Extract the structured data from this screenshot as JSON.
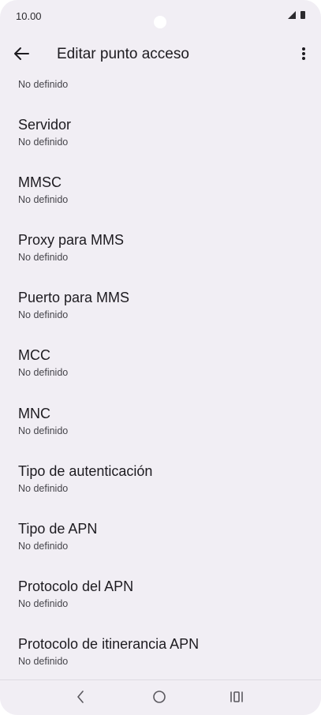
{
  "status_bar": {
    "time": "10.00"
  },
  "app_bar": {
    "title": "Editar punto acceso"
  },
  "list": {
    "cut_summary": "No definido",
    "items": [
      {
        "title": "Servidor",
        "summary": "No definido"
      },
      {
        "title": "MMSC",
        "summary": "No definido"
      },
      {
        "title": "Proxy para MMS",
        "summary": "No definido"
      },
      {
        "title": "Puerto para MMS",
        "summary": "No definido"
      },
      {
        "title": "MCC",
        "summary": "No definido"
      },
      {
        "title": "MNC",
        "summary": "No definido"
      },
      {
        "title": "Tipo de autenticación",
        "summary": "No definido"
      },
      {
        "title": "Tipo de APN",
        "summary": "No definido"
      },
      {
        "title": "Protocolo del APN",
        "summary": "No definido"
      },
      {
        "title": "Protocolo de itinerancia APN",
        "summary": "No definido"
      }
    ]
  },
  "icons": {
    "back": "arrow-back-icon",
    "more": "more-vert-icon",
    "nav_back": "chevron-left-icon",
    "nav_home": "circle-home-icon",
    "nav_recents": "recents-icon"
  }
}
